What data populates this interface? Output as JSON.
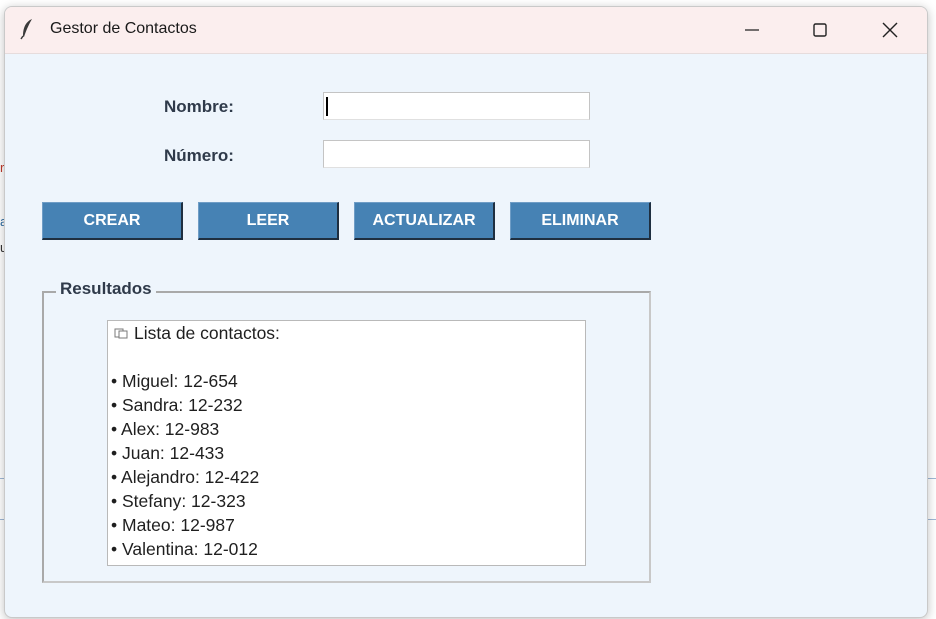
{
  "window": {
    "title": "Gestor de Contactos",
    "icon": "feather-icon",
    "background": "#eef5fc",
    "titlebar_background": "#fbeeee"
  },
  "form": {
    "nombre_label": "Nombre:",
    "numero_label": "Número:",
    "nombre_value": "",
    "numero_value": ""
  },
  "buttons": {
    "crear": "CREAR",
    "leer": "LEER",
    "actualizar": "ACTUALIZAR",
    "eliminar": "ELIMINAR",
    "color": "#4682b4"
  },
  "results": {
    "group_title": "Resultados",
    "header_icon": "address-book-icon",
    "header": "Lista de contactos:",
    "contacts": [
      "• Miguel: 12-654",
      "• Sandra: 12-232",
      "• Alex: 12-983",
      "• Juan: 12-433",
      "• Alejandro: 12-422",
      "• Stefany: 12-323",
      "• Mateo: 12-987",
      "• Valentina: 12-012"
    ]
  }
}
